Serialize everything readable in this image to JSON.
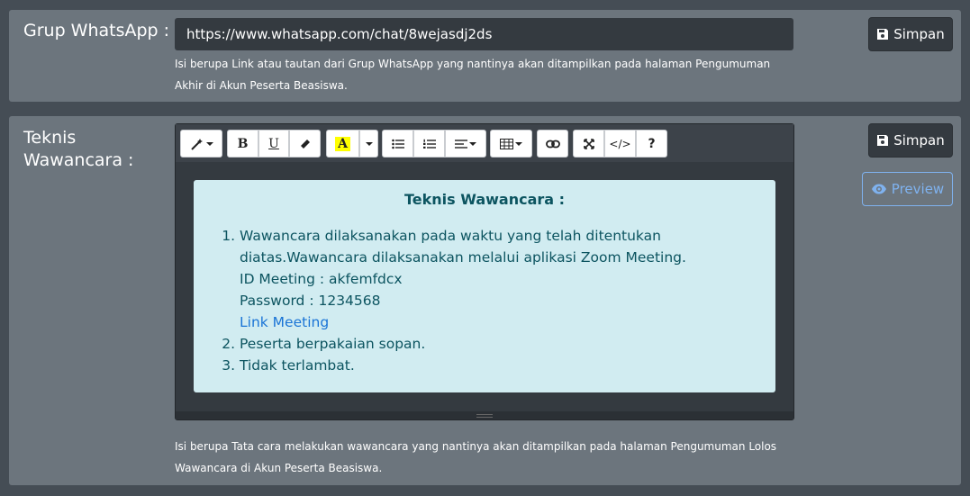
{
  "whatsapp": {
    "label": "Grup WhatsApp :",
    "url_value": "https://www.whatsapp.com/chat/8wejasdj2ds",
    "help": "Isi berupa Link atau tautan dari Grup WhatsApp yang nantinya akan ditampilkan pada halaman Pengumuman Akhir di Akun Peserta Beasiswa.",
    "save_label": "Simpan"
  },
  "interview": {
    "label_line1": "Teknis",
    "label_line2": "Wawancara :",
    "save_label": "Simpan",
    "preview_label": "Preview",
    "help": "Isi berupa Tata cara melakukan wawancara yang nantinya akan ditampilkan pada halaman Pengumuman Lolos Wawancara di Akun Peserta Beasiswa.",
    "toolbar": {
      "bold": "B",
      "underline": "U",
      "highlight": "A",
      "help": "?",
      "code": "</>"
    },
    "content": {
      "title": "Teknis Wawancara :",
      "item1_line1": "Wawancara dilaksanakan pada waktu yang telah ditentukan diatas.Wawancara dilaksanakan melalui aplikasi Zoom Meeting.",
      "item1_line2": "ID Meeting : akfemfdcx",
      "item1_line3": "Password : 1234568",
      "item1_link": "Link Meeting",
      "item2": "Peserta berpakaian sopan.",
      "item3": "Tidak terlambat."
    }
  },
  "colors": {
    "background": "#454d55",
    "card": "#6c757d",
    "dark": "#343a40",
    "info_bg": "#d1ecf1",
    "info_text": "#0c5460",
    "link": "#1a74d6",
    "preview": "#7fb2ef",
    "highlight": "#ffff00"
  }
}
